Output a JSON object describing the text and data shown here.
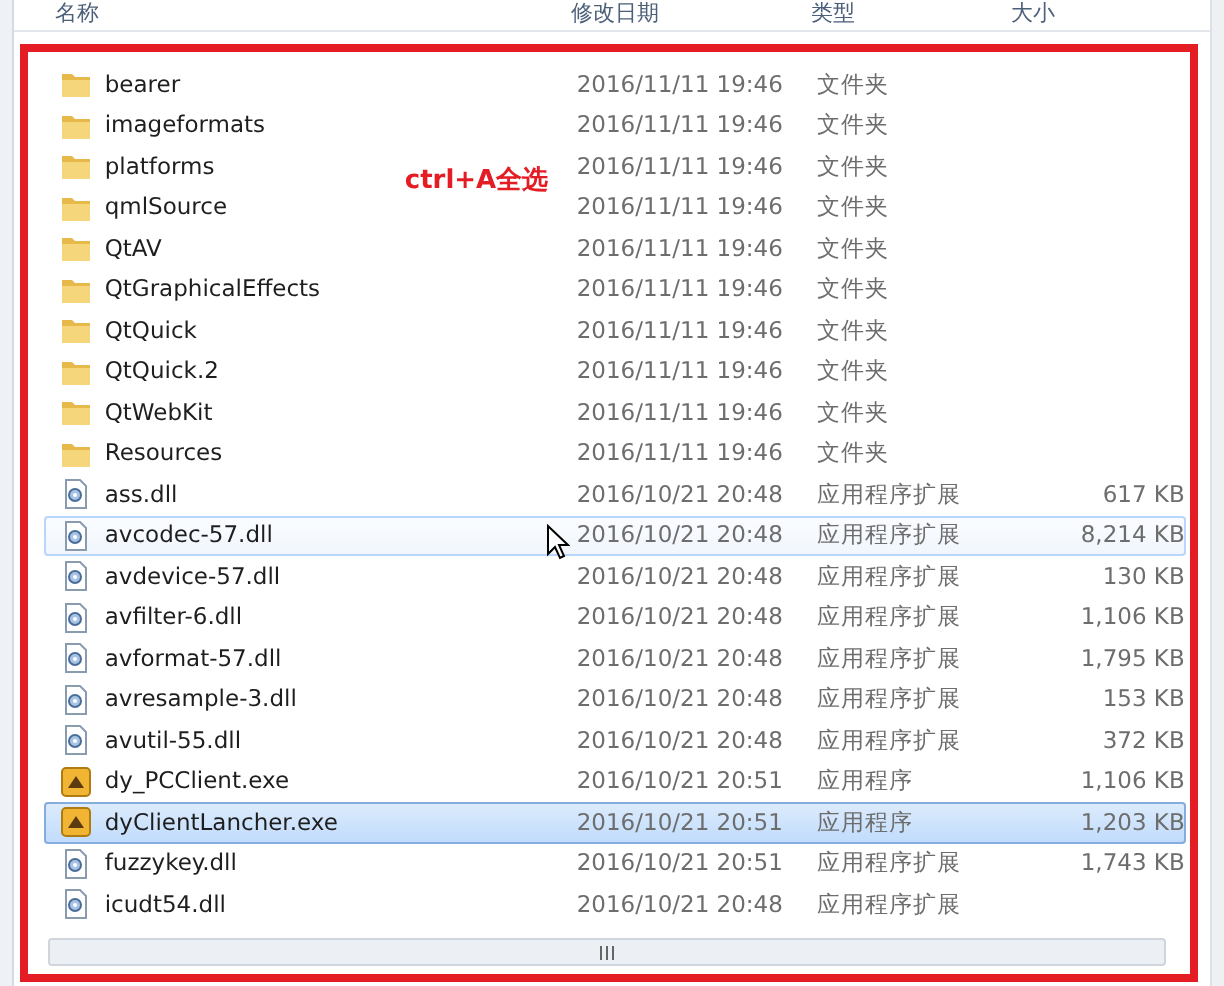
{
  "columns": [
    "名称",
    "修改日期",
    "类型",
    "大小"
  ],
  "annotation": "ctrl+A全选",
  "files": [
    {
      "kind": "folder",
      "name": "bearer",
      "date": "2016/11/11 19:46",
      "type": "文件夹",
      "selected": false,
      "hovered": false
    },
    {
      "kind": "folder",
      "name": "imageformats",
      "date": "2016/11/11 19:46",
      "type": "文件夹",
      "selected": false,
      "hovered": false
    },
    {
      "kind": "folder",
      "name": "platforms",
      "date": "2016/11/11 19:46",
      "type": "文件夹",
      "selected": false,
      "hovered": false
    },
    {
      "kind": "folder",
      "name": "qmlSource",
      "date": "2016/11/11 19:46",
      "type": "文件夹",
      "selected": false,
      "hovered": false
    },
    {
      "kind": "folder",
      "name": "QtAV",
      "date": "2016/11/11 19:46",
      "type": "文件夹",
      "selected": false,
      "hovered": false
    },
    {
      "kind": "folder",
      "name": "QtGraphicalEffects",
      "date": "2016/11/11 19:46",
      "type": "文件夹",
      "selected": false,
      "hovered": false
    },
    {
      "kind": "folder",
      "name": "QtQuick",
      "date": "2016/11/11 19:46",
      "type": "文件夹",
      "selected": false,
      "hovered": false
    },
    {
      "kind": "folder",
      "name": "QtQuick.2",
      "date": "2016/11/11 19:46",
      "type": "文件夹",
      "selected": false,
      "hovered": false
    },
    {
      "kind": "folder",
      "name": "QtWebKit",
      "date": "2016/11/11 19:46",
      "type": "文件夹",
      "selected": false,
      "hovered": false
    },
    {
      "kind": "folder",
      "name": "Resources",
      "date": "2016/11/11 19:46",
      "type": "文件夹",
      "selected": false,
      "hovered": false
    },
    {
      "kind": "dll",
      "name": "ass.dll",
      "date": "2016/10/21 20:48",
      "type": "应用程序扩展",
      "size": "617 KB",
      "selected": false,
      "hovered": false
    },
    {
      "kind": "dll",
      "name": "avcodec-57.dll",
      "date": "2016/10/21 20:48",
      "type": "应用程序扩展",
      "size": "8,214 KB",
      "selected": false,
      "hovered": true
    },
    {
      "kind": "dll",
      "name": "avdevice-57.dll",
      "date": "2016/10/21 20:48",
      "type": "应用程序扩展",
      "size": "130 KB",
      "selected": false,
      "hovered": false
    },
    {
      "kind": "dll",
      "name": "avfilter-6.dll",
      "date": "2016/10/21 20:48",
      "type": "应用程序扩展",
      "size": "1,106 KB",
      "selected": false,
      "hovered": false
    },
    {
      "kind": "dll",
      "name": "avformat-57.dll",
      "date": "2016/10/21 20:48",
      "type": "应用程序扩展",
      "size": "1,795 KB",
      "selected": false,
      "hovered": false
    },
    {
      "kind": "dll",
      "name": "avresample-3.dll",
      "date": "2016/10/21 20:48",
      "type": "应用程序扩展",
      "size": "153 KB",
      "selected": false,
      "hovered": false
    },
    {
      "kind": "dll",
      "name": "avutil-55.dll",
      "date": "2016/10/21 20:48",
      "type": "应用程序扩展",
      "size": "372 KB",
      "selected": false,
      "hovered": false
    },
    {
      "kind": "exe",
      "name": "dy_PCClient.exe",
      "date": "2016/10/21 20:51",
      "type": "应用程序",
      "size": "1,106 KB",
      "selected": false,
      "hovered": false
    },
    {
      "kind": "exe",
      "name": "dyClientLancher.exe",
      "date": "2016/10/21 20:51",
      "type": "应用程序",
      "size": "1,203 KB",
      "selected": true,
      "hovered": false
    },
    {
      "kind": "dll",
      "name": "fuzzykey.dll",
      "date": "2016/10/21 20:51",
      "type": "应用程序扩展",
      "size": "1,743 KB",
      "selected": false,
      "hovered": false
    },
    {
      "kind": "dll",
      "name": "icudt54.dll",
      "date": "2016/10/21 20:48",
      "type": "应用程序扩展",
      "selected": false,
      "hovered": false
    }
  ]
}
